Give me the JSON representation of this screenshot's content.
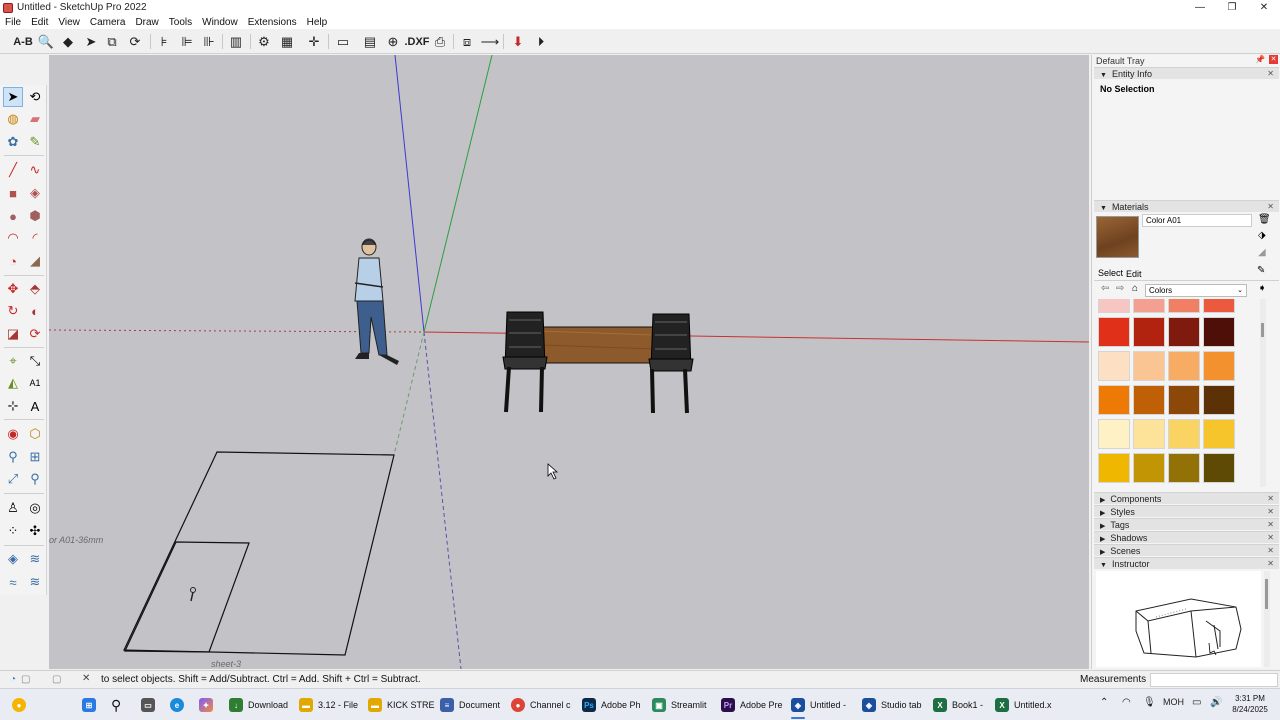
{
  "window": {
    "title": "Untitled - SketchUp Pro 2022",
    "controls": [
      "—",
      "❐",
      "✕"
    ]
  },
  "menu": [
    "File",
    "Edit",
    "View",
    "Camera",
    "Draw",
    "Tools",
    "Window",
    "Extensions",
    "Help"
  ],
  "toolbar": {
    "ab_label": "A-B",
    "dxf_label": ".DXF"
  },
  "viewport": {
    "label_left": "or A01-36mm",
    "label_sheet": "sheet-3",
    "background": "#c3c3c7"
  },
  "tray": {
    "title": "Default Tray",
    "entity_info": {
      "header": "Entity Info",
      "value": "No Selection"
    },
    "materials": {
      "header": "Materials",
      "name_value": "Color A01",
      "tab_select": "Select",
      "tab_edit": "Edit",
      "library": "Colors",
      "swatches": [
        "#f7c6c2",
        "#f3a093",
        "#f07f63",
        "#ec5a3d",
        "#e0301a",
        "#b2230f",
        "#7f1a0e",
        "#4e0f08",
        "#fde0c4",
        "#fbc593",
        "#f8ab63",
        "#f3912f",
        "#ec7a05",
        "#c06006",
        "#8c4808",
        "#5c3106",
        "#fff1c6",
        "#fde39a",
        "#fad462",
        "#f6c52c",
        "#f0b700",
        "#c19503",
        "#927206",
        "#5e4a05"
      ]
    },
    "collapsed_panels": [
      "Components",
      "Styles",
      "Tags",
      "Shadows",
      "Scenes"
    ],
    "instructor": {
      "header": "Instructor"
    }
  },
  "statusbar": {
    "text": "to select objects. Shift = Add/Subtract. Ctrl = Add. Shift + Ctrl = Subtract.",
    "measurements_label": "Measurements"
  },
  "taskbar": {
    "items": [
      {
        "label": "Download",
        "color": "#2e7d32"
      },
      {
        "label": "3.12 - File",
        "color": "#e0a800"
      },
      {
        "label": "KICK STRE",
        "color": "#e0a800"
      },
      {
        "label": "Document",
        "color": "#3b5fa8"
      },
      {
        "label": "Channel c",
        "color": "#db4437"
      },
      {
        "label": "Adobe Ph",
        "color": "#0b2a4a"
      },
      {
        "label": "Streamlit",
        "color": "#2d8a5e"
      },
      {
        "label": "Adobe Pre",
        "color": "#2a0f4a"
      },
      {
        "label": "Untitled -",
        "color": "#1a4f9c"
      },
      {
        "label": "Studio tab",
        "color": "#1a4f9c"
      },
      {
        "label": "Book1 -",
        "color": "#1d6f42"
      },
      {
        "label": "Untitled.x",
        "color": "#1d6f42"
      }
    ],
    "lang": "MOH",
    "time": "3:31 PM",
    "date": "8/24/2025"
  }
}
